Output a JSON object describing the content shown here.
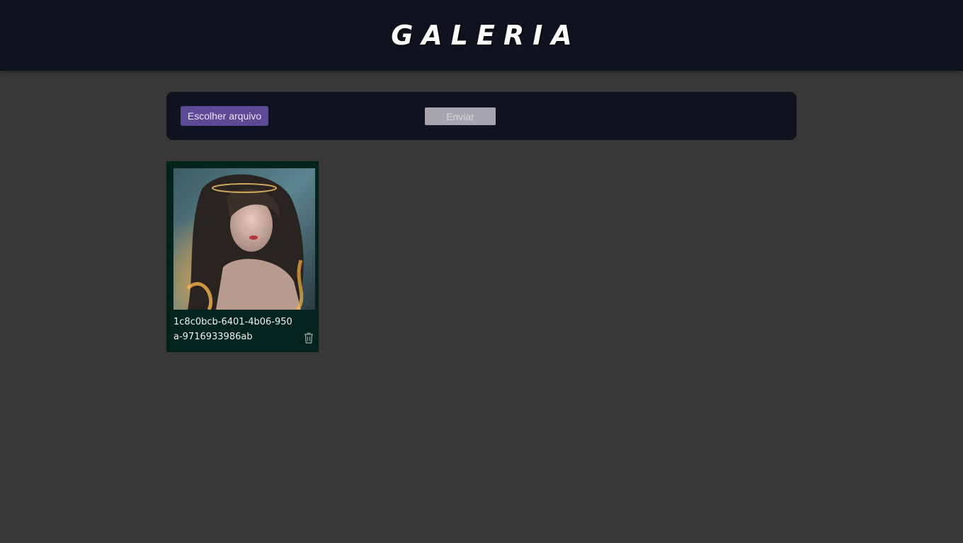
{
  "header": {
    "title": "GALERIA"
  },
  "upload": {
    "choose_file_label": "Escolher arquivo",
    "send_label": "Enviar"
  },
  "gallery": {
    "items": [
      {
        "name": "1c8c0bcb-6401-4b06-950a-9716933986ab",
        "image": "fantasy-portrait-girl-long-hair"
      }
    ]
  },
  "icons": {
    "delete": "trash-icon"
  },
  "colors": {
    "header_bg": "#0f1320",
    "page_bg": "#383838",
    "choose_button": "#5d4a97",
    "send_button_disabled": "#a9a5ae",
    "card_bg": "#03241d"
  }
}
